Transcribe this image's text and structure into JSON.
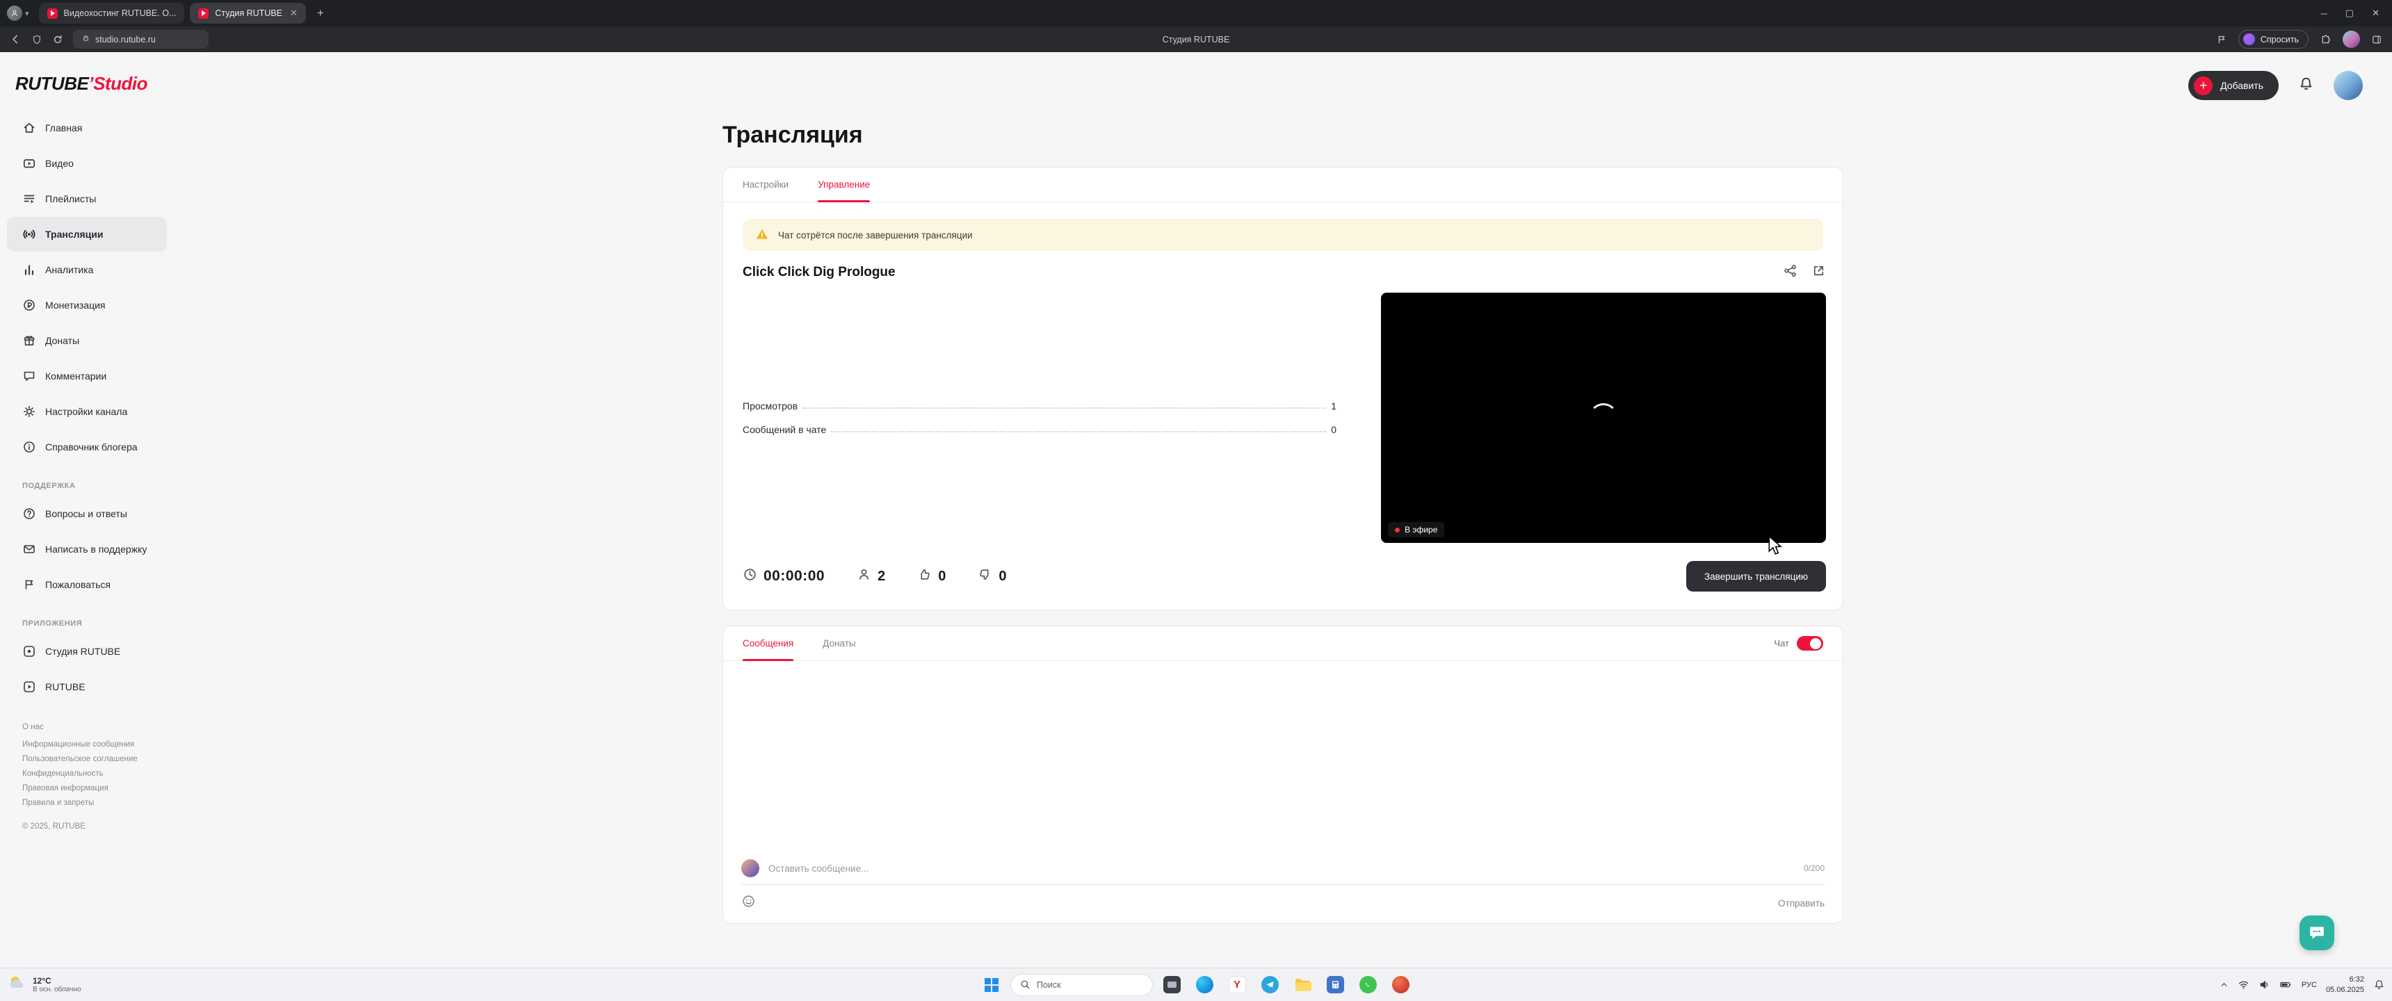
{
  "accent": "#ed143b",
  "browser": {
    "tab1_title": "Видеохостинг RUTUBE. О...",
    "tab2_title": "Студия RUTUBE",
    "url": "studio.rutube.ru",
    "page_title": "Студия RUTUBE",
    "ask_label": "Спросить"
  },
  "header": {
    "add_label": "Добавить"
  },
  "sidebar": {
    "logo_black": "RUTUBE",
    "logo_sep": "’",
    "logo_red": "Studio",
    "items": [
      {
        "label": "Главная"
      },
      {
        "label": "Видео"
      },
      {
        "label": "Плейлисты"
      },
      {
        "label": "Трансляции"
      },
      {
        "label": "Аналитика"
      },
      {
        "label": "Монетизация"
      },
      {
        "label": "Донаты"
      },
      {
        "label": "Комментарии"
      },
      {
        "label": "Настройки канала"
      },
      {
        "label": "Справочник блогера"
      }
    ],
    "support_header": "ПОДДЕРЖКА",
    "support": [
      {
        "label": "Вопросы и ответы"
      },
      {
        "label": "Написать в поддержку"
      },
      {
        "label": "Пожаловаться"
      }
    ],
    "apps_header": "ПРИЛОЖЕНИЯ",
    "apps": [
      {
        "label": "Студия RUTUBE"
      },
      {
        "label": "RUTUBE"
      }
    ],
    "footer": {
      "links": [
        "О нас",
        "Информационные сообщения",
        "Пользовательское соглашение",
        "Конфиденциальность",
        "Правовая информация",
        "Правила и запреты"
      ],
      "copyright": "© 2025, RUTUBE"
    }
  },
  "main": {
    "title": "Трансляция",
    "tab_settings": "Настройки",
    "tab_control": "Управление",
    "warning_text": "Чат сотрётся после завершения трансляции",
    "broadcast": {
      "title": "Click Click Dig Prologue",
      "stat_views_label": "Просмотров",
      "stat_views_value": "1",
      "stat_messages_label": "Сообщений в чате",
      "stat_messages_value": "0",
      "live_label": "В эфире",
      "timer": "00:00:00",
      "viewers": "2",
      "likes": "0",
      "dislikes": "0",
      "end_button": "Завершить трансляцию"
    },
    "chat": {
      "tab_messages": "Сообщения",
      "tab_donations": "Донаты",
      "toggle_label": "Чат",
      "placeholder": "Оставить сообщение...",
      "counter": "0/200",
      "send_label": "Отправить"
    }
  },
  "taskbar": {
    "weather_temp": "12°C",
    "weather_desc": "В осн. облачно",
    "search_placeholder": "Поиск",
    "language": "РУС",
    "time": "6:32",
    "date": "05.06.2025"
  }
}
